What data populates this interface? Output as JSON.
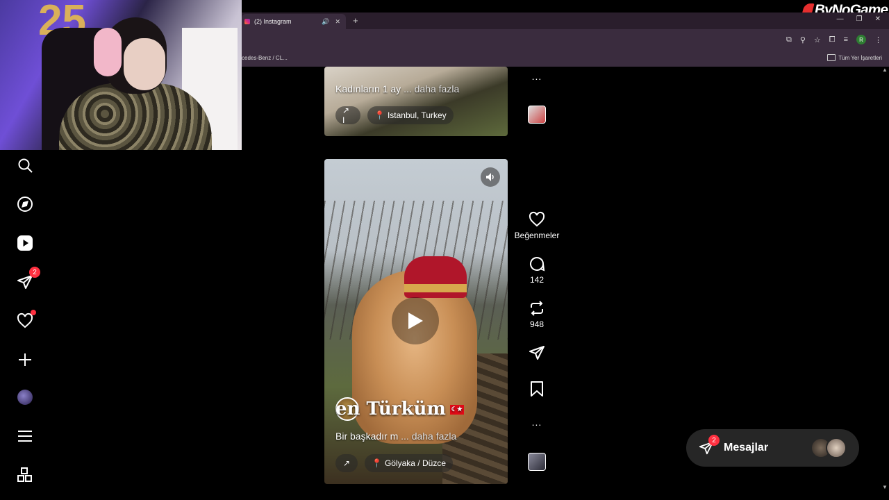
{
  "browser": {
    "tab_title": "(2) Instagram",
    "new_tab": "+",
    "bookmark_left": "cedes-Benz / CL...",
    "bookmark_right": "Tüm Yer İşaretleri",
    "profile_initial": "R"
  },
  "overlay_logo": "ByNoGame",
  "nav": {
    "items": [
      {
        "icon": "search-icon"
      },
      {
        "icon": "compass-icon"
      },
      {
        "icon": "reels-icon"
      },
      {
        "icon": "messenger-icon",
        "badge": "2"
      },
      {
        "icon": "heart-icon",
        "dot": true
      },
      {
        "icon": "plus-icon"
      },
      {
        "icon": "profile-avatar"
      },
      {
        "icon": "menu-icon"
      },
      {
        "icon": "apps-icon"
      }
    ]
  },
  "feed": {
    "reel1": {
      "caption": "Kadınların 1 ay",
      "more": "... daha fazla",
      "share_chip": "↗ I",
      "location": "Istanbul, Turkey"
    },
    "reel2": {
      "title_art": "en Türküm",
      "caption": "Bir başkadır m",
      "more": "... daha fazla",
      "share_chip": "↗",
      "location": "Gölyaka / Düzce"
    }
  },
  "actions": {
    "likes_label": "Beğenmeler",
    "comments_count": "142",
    "reposts_count": "948",
    "more": "..."
  },
  "messages": {
    "label": "Mesajlar",
    "badge": "2"
  },
  "colors": {
    "accent_red": "#ff3040",
    "chrome_bg": "#3a2c3e",
    "page_bg": "#000000"
  }
}
